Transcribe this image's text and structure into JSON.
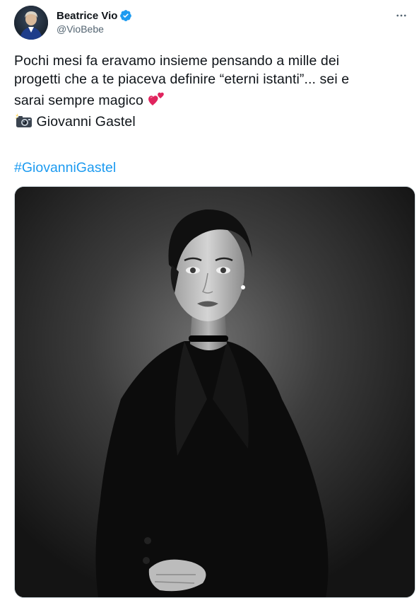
{
  "author": {
    "display_name": "Beatrice Vio",
    "handle": "@VioBebe",
    "verified": true,
    "avatar_icon": "profile-avatar"
  },
  "tweet": {
    "line1": "Pochi mesi fa eravamo insieme pensando a mille dei",
    "line2": "progetti che a te piaceva definire “eterni istanti”... sei e",
    "line3": "sarai sempre magico",
    "line3_emoji": "two-hearts-emoji",
    "credit": "Giovanni Gastel",
    "credit_emoji": "camera-with-flash-emoji",
    "hashtag": "#GiovanniGastel"
  },
  "media": {
    "type": "black-and-white portrait photo"
  },
  "colors": {
    "link": "#1d9bf0",
    "text": "#0f1419",
    "secondary": "#536471",
    "verified": "#1d9bf0"
  },
  "icons": {
    "more": "more-horizontal-icon",
    "verified": "verified-badge-icon"
  }
}
